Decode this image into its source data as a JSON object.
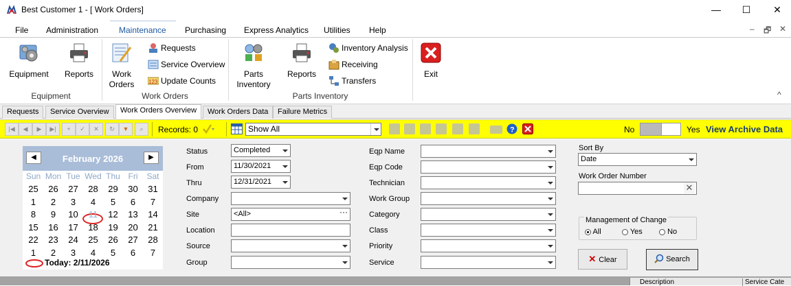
{
  "window": {
    "title": "Best Customer 1 - [ Work Orders]",
    "minimize": "—",
    "maximize": "☐",
    "close": "✕"
  },
  "menu": {
    "items": [
      "File",
      "Administration",
      "Maintenance",
      "Purchasing",
      "Express Analytics",
      "Utilities",
      "Help"
    ],
    "active": "Maintenance",
    "mdi": {
      "minimize": "–",
      "restore": "🗗",
      "close": "✕"
    }
  },
  "ribbon": {
    "equipment_group": {
      "label": "Equipment",
      "equipment": "Equipment",
      "reports": "Reports"
    },
    "work_orders_group": {
      "label": "Work Orders",
      "work_orders_line1": "Work",
      "work_orders_line2": "Orders",
      "requests": "Requests",
      "service_overview": "Service Overview",
      "update_counts": "Update Counts"
    },
    "parts_group": {
      "label": "Parts Inventory",
      "parts_line1": "Parts",
      "parts_line2": "Inventory",
      "reports": "Reports",
      "inventory_analysis": "Inventory Analysis",
      "receiving": "Receiving",
      "transfers": "Transfers"
    },
    "exit": "Exit",
    "collapse_glyph": "^"
  },
  "doc_tabs": [
    "Requests",
    "Service Overview",
    "Work Orders Overview",
    "Work Orders Data",
    "Failure Metrics"
  ],
  "active_doc_tab": "Work Orders Overview",
  "toolbar": {
    "records": "Records: 0",
    "filter_value": "Show All",
    "archive_no": "No",
    "archive_yes": "Yes",
    "view_archive": "View Archive Data"
  },
  "calendar": {
    "month": "February 2026",
    "weekdays": [
      "Sun",
      "Mon",
      "Tue",
      "Wed",
      "Thu",
      "Fri",
      "Sat"
    ],
    "weeks": [
      [
        "25",
        "26",
        "27",
        "28",
        "29",
        "30",
        "31"
      ],
      [
        "1",
        "2",
        "3",
        "4",
        "5",
        "6",
        "7"
      ],
      [
        "8",
        "9",
        "10",
        "11",
        "12",
        "13",
        "14"
      ],
      [
        "15",
        "16",
        "17",
        "18",
        "19",
        "20",
        "21"
      ],
      [
        "22",
        "23",
        "24",
        "25",
        "26",
        "27",
        "28"
      ],
      [
        "1",
        "2",
        "3",
        "4",
        "5",
        "6",
        "7"
      ]
    ],
    "today_label": "Today: 2/11/2026",
    "selected_day": "11"
  },
  "filters": {
    "status": {
      "label": "Status",
      "value": "Completed"
    },
    "from": {
      "label": "From",
      "value": "11/30/2021"
    },
    "thru": {
      "label": "Thru",
      "value": "12/31/2021"
    },
    "company": {
      "label": "Company",
      "value": ""
    },
    "site": {
      "label": "Site",
      "value": "<All>"
    },
    "location": {
      "label": "Location",
      "value": ""
    },
    "source": {
      "label": "Source",
      "value": ""
    },
    "group": {
      "label": "Group",
      "value": ""
    },
    "eqp_name": {
      "label": "Eqp Name",
      "value": ""
    },
    "eqp_code": {
      "label": "Eqp Code",
      "value": ""
    },
    "technician": {
      "label": "Technician",
      "value": ""
    },
    "work_group": {
      "label": "Work Group",
      "value": ""
    },
    "category": {
      "label": "Category",
      "value": ""
    },
    "class": {
      "label": "Class",
      "value": ""
    },
    "priority": {
      "label": "Priority",
      "value": ""
    },
    "service": {
      "label": "Service",
      "value": ""
    },
    "sort_by": {
      "label": "Sort By",
      "value": "Date"
    },
    "work_order_number": {
      "label": "Work Order Number",
      "value": ""
    },
    "management_of_change": {
      "label": "Management of Change",
      "all": "All",
      "yes": "Yes",
      "no": "No",
      "selected": "All"
    },
    "clear": "Clear",
    "search": "Search"
  },
  "grid_headers": [
    "Description",
    "Service Cate"
  ]
}
